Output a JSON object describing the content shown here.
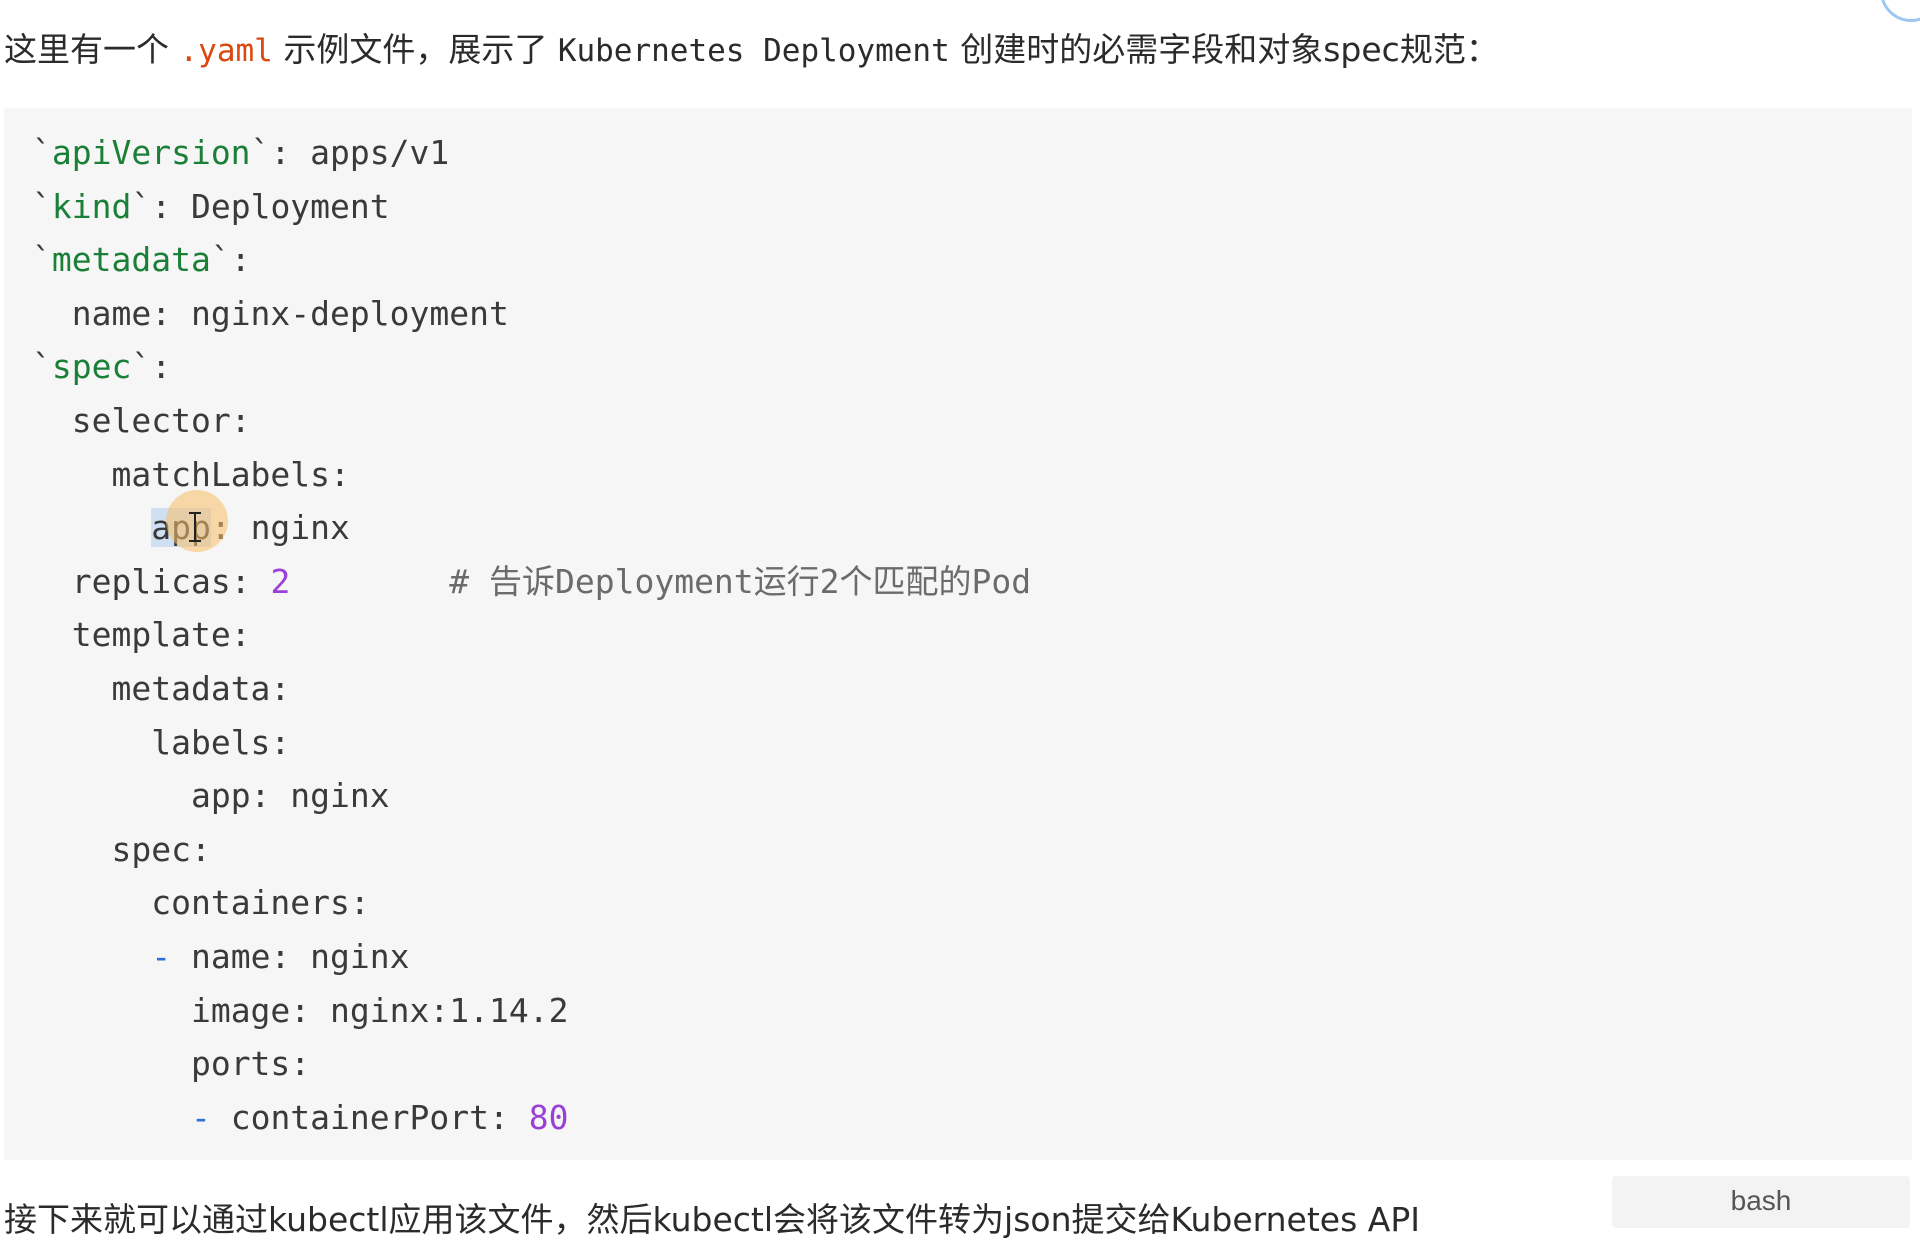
{
  "intro": {
    "prefix": "这里有一个 ",
    "filename": ".yaml",
    "middle": " 示例文件，展示了 ",
    "subject": "Kubernetes Deployment",
    "suffix": " 创建时的必需字段和对象spec规范："
  },
  "code": {
    "lines": [
      {
        "indent": "",
        "tick_key": "apiVersion",
        "rest": ": apps/v1"
      },
      {
        "indent": "",
        "tick_key": "kind",
        "rest": ": Deployment"
      },
      {
        "indent": "",
        "tick_key": "metadata",
        "rest": ":"
      },
      {
        "indent": "  ",
        "plain": "name: nginx-deployment"
      },
      {
        "indent": "",
        "tick_key": "spec",
        "rest": ":"
      },
      {
        "indent": "  ",
        "plain": "selector:"
      },
      {
        "indent": "    ",
        "plain": "matchLabels:"
      },
      {
        "indent": "      ",
        "selected": "app",
        "plain": ": nginx"
      },
      {
        "indent": "  ",
        "plain": "replicas: ",
        "num": "2",
        "comment": "        # 告诉Deployment运行2个匹配的Pod"
      },
      {
        "indent": "  ",
        "plain": "template:"
      },
      {
        "indent": "    ",
        "plain": "metadata:"
      },
      {
        "indent": "      ",
        "plain": "labels:"
      },
      {
        "indent": "        ",
        "plain": "app: nginx"
      },
      {
        "indent": "    ",
        "plain": "spec:"
      },
      {
        "indent": "      ",
        "plain": "containers:"
      },
      {
        "indent": "      ",
        "dash": "- ",
        "plain": "name: nginx"
      },
      {
        "indent": "        ",
        "plain": "image: nginx:1.14.2"
      },
      {
        "indent": "        ",
        "plain": "ports:"
      },
      {
        "indent": "        ",
        "dash": "- ",
        "plain": "containerPort: ",
        "num": "80"
      }
    ]
  },
  "outro": {
    "text": "接下来就可以通过kubectl应用该文件，然后kubectl会将该文件转为json提交给Kubernetes API"
  },
  "lang_badge": "bash",
  "colors": {
    "key_green": "#1a7f37",
    "number_purple": "#9b3fd6",
    "inline_code": "#d9480f",
    "dash_blue": "#2d6fdb",
    "selection": "#cfe0f3"
  },
  "icons": {
    "cursor": "ibeam-icon"
  }
}
